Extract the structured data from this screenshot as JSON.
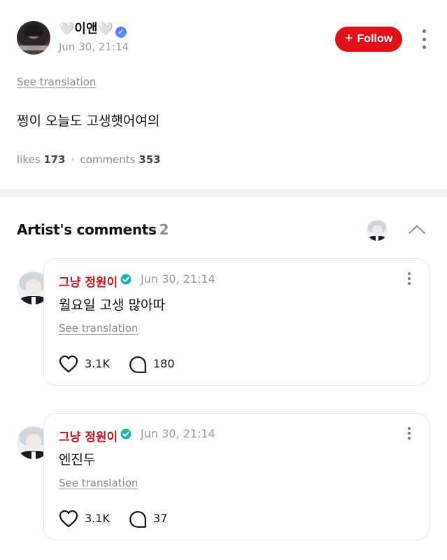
{
  "post": {
    "author": "🤍이앤🤍",
    "date": "Jun 30, 21:14",
    "follow_label": "Follow",
    "see_translation": "See translation",
    "body": "쩡이 오늘도 고생햇어여의",
    "likes_label": "likes",
    "likes_count": "173",
    "comments_label": "comments",
    "comments_count": "353"
  },
  "artist_comments": {
    "title": "Artist's comments",
    "count": "2",
    "items": [
      {
        "author": "그냥 정원이",
        "date": "Jun 30, 21:14",
        "text": "월요일 고생 많아따",
        "see_translation": "See translation",
        "likes": "3.1K",
        "replies": "180"
      },
      {
        "author": "그냥 정원이",
        "date": "Jun 30, 21:14",
        "text": "엔진두",
        "see_translation": "See translation",
        "likes": "3.1K",
        "replies": "37"
      }
    ]
  },
  "colors": {
    "accent": "#e0111b",
    "artist_name": "#c4161c",
    "verified": "#1fb5a8",
    "muted": "#9a9a9a"
  },
  "icons": [
    "more-vertical-icon",
    "plus-icon",
    "verified-badge-icon",
    "chevron-up-icon",
    "heart-icon",
    "comment-bubble-icon",
    "check-circle-icon"
  ]
}
